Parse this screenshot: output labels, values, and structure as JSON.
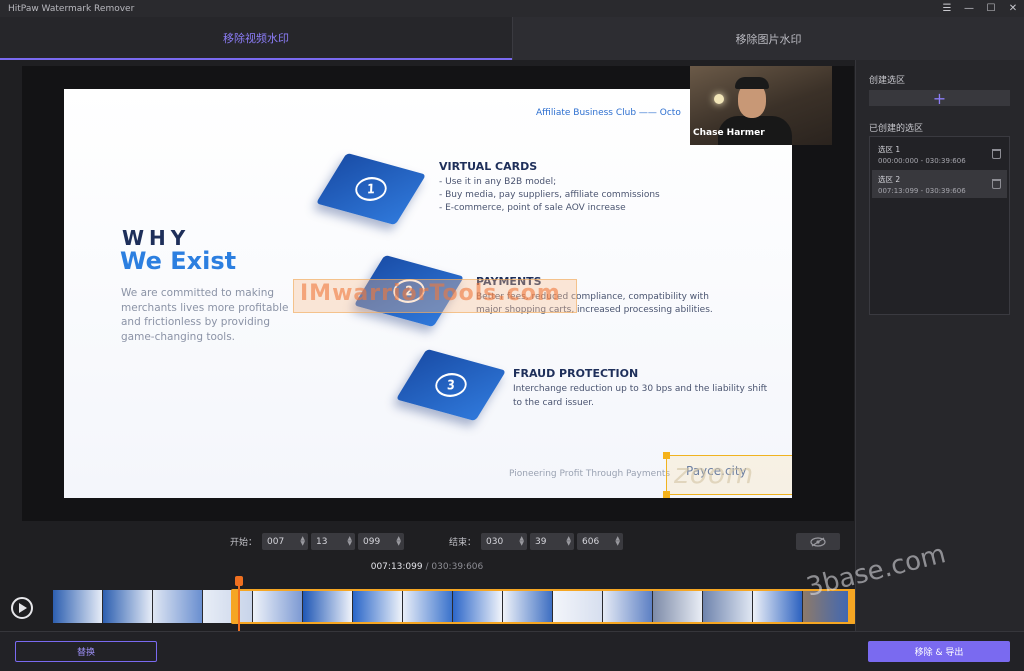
{
  "app": {
    "title": "HitPaw Watermark Remover"
  },
  "window_controls": {
    "menu": "☰",
    "minimize": "—",
    "maximize": "☐",
    "close": "✕"
  },
  "tabs": [
    {
      "label": "移除视频水印",
      "active": true
    },
    {
      "label": "移除图片水印",
      "active": false
    }
  ],
  "video": {
    "slide": {
      "club": "Affiliate Business Club —— Octo",
      "why": "WHY",
      "exist": "We Exist",
      "mission": "We are committed to making merchants lives more profitable and frictionless by providing game-changing tools.",
      "features": [
        {
          "num": "1",
          "title": "VIRTUAL CARDS",
          "lines": [
            "- Use it in any B2B model;",
            "- Buy media, pay suppliers, affiliate commissions",
            "- E-commerce, point of sale AOV increase"
          ]
        },
        {
          "num": "2",
          "title": "PAYMENTS",
          "lines": [
            "Better fees, reduced compliance, compatibility with",
            "major shopping carts, increased processing abilities."
          ]
        },
        {
          "num": "3",
          "title": "FRAUD PROTECTION",
          "lines": [
            "Interchange reduction up to 30 bps and the liability shift",
            "to the card issuer."
          ]
        }
      ],
      "pioneer": "Pioneering Profit Through Payments",
      "payce": "Payce.city",
      "overlay_watermark": "IMwarriorTools.com",
      "zoom_watermark": "zoom"
    },
    "webcam_name": "Chase Harmer"
  },
  "time_controls": {
    "start_label": "开始：",
    "start": {
      "h": "007",
      "m": "13",
      "ms": "099"
    },
    "end_label": "结束：",
    "end": {
      "h": "030",
      "m": "39",
      "ms": "606"
    },
    "current": "007:13:099",
    "total": "/ 030:39:606"
  },
  "side_panel": {
    "create_label": "创建选区",
    "add_symbol": "+",
    "created_label": "已创建的选区",
    "selections": [
      {
        "name": "选区 1",
        "range": "000:00:000 - 030:39:606",
        "active": false
      },
      {
        "name": "选区 2",
        "range": "007:13:099 - 030:39:606",
        "active": true
      }
    ]
  },
  "bottom": {
    "replace": "替换",
    "export": "移除 & 导出"
  },
  "site_watermark": "3base.com",
  "colors": {
    "accent": "#7a6af0",
    "range": "#f5a623",
    "playhead": "#f07020"
  }
}
